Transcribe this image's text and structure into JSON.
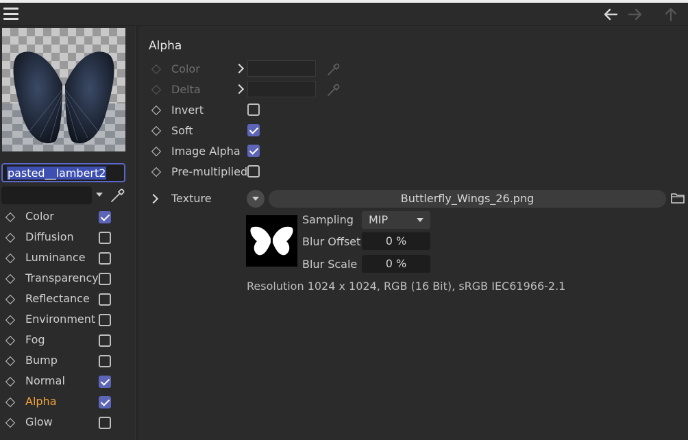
{
  "toolbar": {
    "menu_icon": "hamburger-menu-icon",
    "back_icon": "arrow-left-icon",
    "forward_icon": "arrow-right-icon",
    "up_icon": "arrow-up-icon"
  },
  "material": {
    "name": "pasted__lambert2",
    "search_value": ""
  },
  "channels": [
    {
      "label": "Color",
      "checked": true
    },
    {
      "label": "Diffusion",
      "checked": false
    },
    {
      "label": "Luminance",
      "checked": false
    },
    {
      "label": "Transparency",
      "checked": false
    },
    {
      "label": "Reflectance",
      "checked": false
    },
    {
      "label": "Environment",
      "checked": false
    },
    {
      "label": "Fog",
      "checked": false
    },
    {
      "label": "Bump",
      "checked": false
    },
    {
      "label": "Normal",
      "checked": true
    },
    {
      "label": "Alpha",
      "checked": true,
      "active": true
    },
    {
      "label": "Glow",
      "checked": false
    }
  ],
  "alpha": {
    "title": "Alpha",
    "color_label": "Color",
    "delta_label": "Delta",
    "invert_label": "Invert",
    "invert": false,
    "soft_label": "Soft",
    "soft": true,
    "image_alpha_label": "Image Alpha",
    "image_alpha": true,
    "premultiplied_label": "Pre-multiplied",
    "premultiplied": false,
    "texture_label": "Texture",
    "texture_file": "Buttlerfly_Wings_26.png",
    "sampling_label": "Sampling",
    "sampling_value": "MIP",
    "blur_offset_label": "Blur Offset",
    "blur_offset_value": "0 %",
    "blur_scale_label": "Blur Scale",
    "blur_scale_value": "0 %",
    "resolution": "Resolution 1024 x 1024, RGB (16 Bit), sRGB IEC61966-2.1"
  },
  "colors": {
    "accent": "#5d65b8",
    "active_channel": "#f2a33a",
    "background": "#2b2b2b"
  }
}
